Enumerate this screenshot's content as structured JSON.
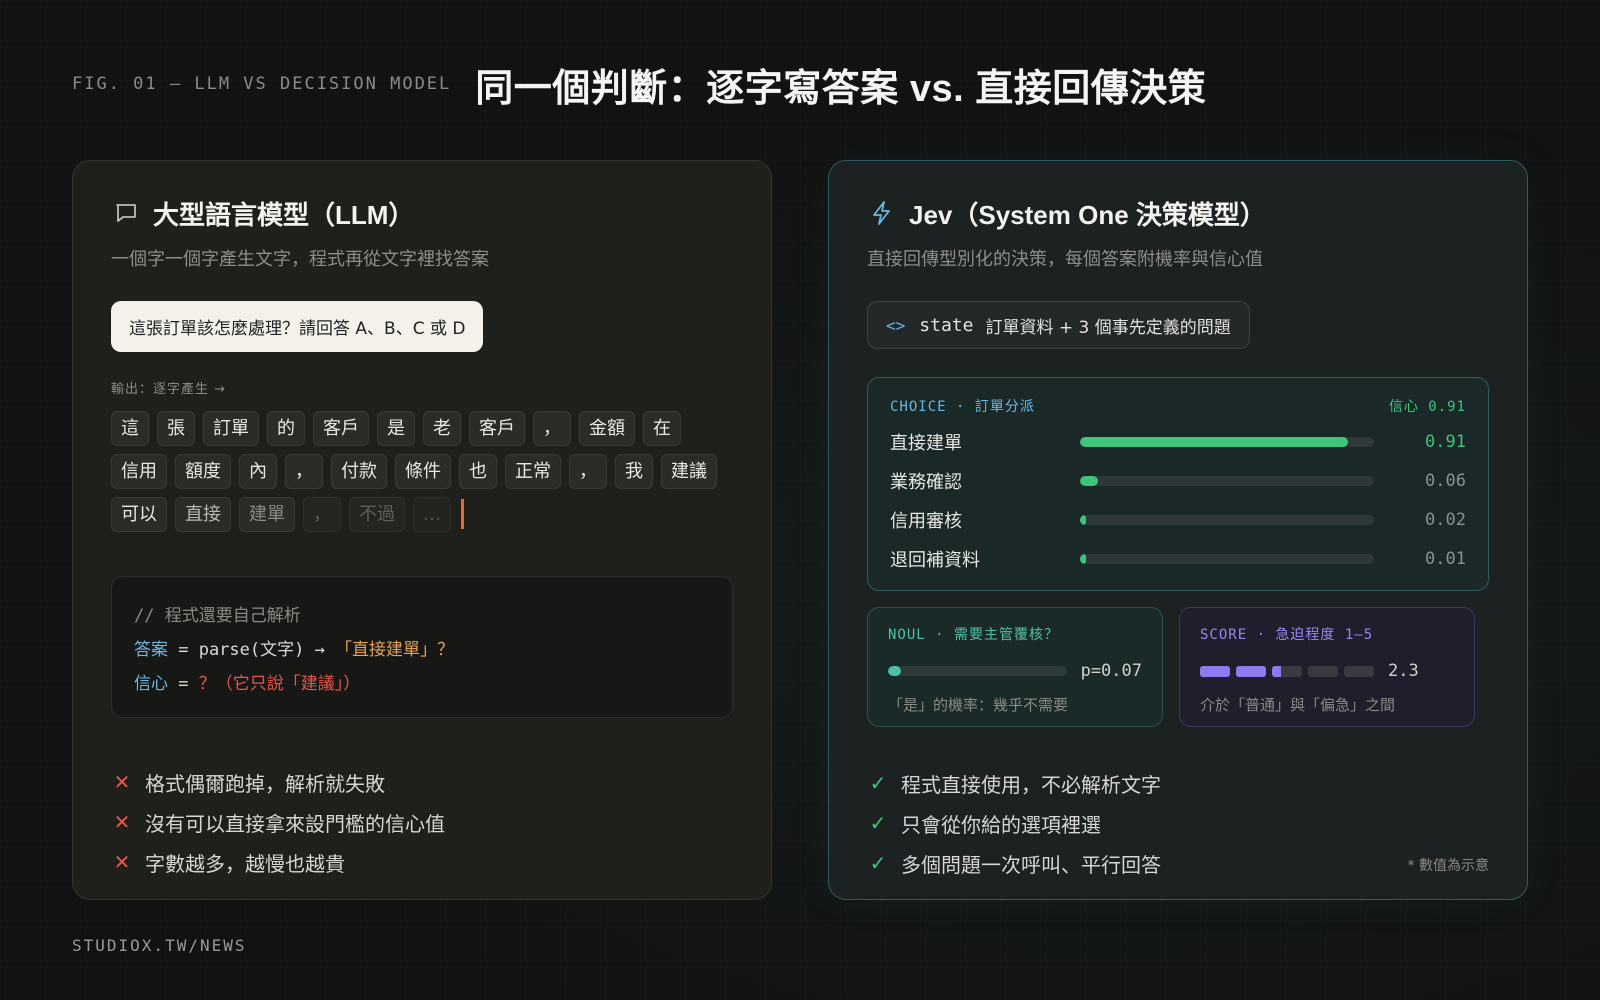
{
  "header": {
    "fig_label": "FIG. 01 — LLM VS DECISION MODEL",
    "title": "同一個判斷：逐字寫答案 vs. 直接回傳決策"
  },
  "left": {
    "icon": "chat-bubble-icon",
    "title": "大型語言模型（LLM）",
    "subtitle": "一個字一個字產生文字，程式再從文字裡找答案",
    "prompt": "這張訂單該怎麼處理？請回答 A、B、C 或 D",
    "output_label": "輸出：逐字產生 →",
    "tokens": [
      "這",
      "張",
      "訂單",
      "的",
      "客戶",
      "是",
      "老",
      "客戶",
      "，",
      "金額",
      "在",
      "信用",
      "額度",
      "內",
      "，",
      "付款",
      "條件",
      "也",
      "正常",
      "，",
      "我",
      "建議",
      "可以",
      "直接",
      "建單",
      "，",
      "不過",
      "…"
    ],
    "code": {
      "comment": "// 程式還要自己解析",
      "line1_var": "答案",
      "line1_op": " = parse(文字) → ",
      "line1_str": "「直接建單」？",
      "line2_var": "信心",
      "line2_op": " = ",
      "line2_red": "？（它只說「建議」）"
    },
    "bullets": [
      "格式偶爾跑掉，解析就失敗",
      "沒有可以直接拿來設門檻的信心值",
      "字數越多，越慢也越貴"
    ]
  },
  "right": {
    "icon": "lightning-icon",
    "title": "Jev（System One 決策模型）",
    "subtitle": "直接回傳型別化的決策，每個答案附機率與信心值",
    "state": {
      "code_icon": "<>",
      "keyword": "state",
      "text": "訂單資料 + 3 個事先定義的問題"
    },
    "choice": {
      "label": "CHOICE · 訂單分派",
      "confidence": "信心 0.91",
      "options": [
        {
          "name": "直接建單",
          "value": 0.91,
          "label": "0.91"
        },
        {
          "name": "業務確認",
          "value": 0.06,
          "label": "0.06"
        },
        {
          "name": "信用審核",
          "value": 0.02,
          "label": "0.02"
        },
        {
          "name": "退回補資料",
          "value": 0.01,
          "label": "0.01"
        }
      ]
    },
    "noul": {
      "label": "NOUL · 需要主管覆核？",
      "value": 0.07,
      "value_label": "p=0.07",
      "note": "「是」的機率：幾乎不需要"
    },
    "score": {
      "label": "SCORE · 急迫程度 1–5",
      "value": 2.3,
      "max": 5,
      "value_label": "2.3",
      "note": "介於「普通」與「偏急」之間"
    },
    "bullets": [
      "程式直接使用，不必解析文字",
      "只會從你給的選項裡選",
      "多個問題一次呼叫、平行回答"
    ],
    "footnote": "* 數值為示意"
  },
  "footer": "STUDIOX.TW/NEWS",
  "colors": {
    "green": "#3fc47c",
    "red": "#e5574a",
    "blue": "#6ab8e0",
    "teal": "#4ec0a8",
    "purple": "#8f78f0",
    "orange": "#e86a3c"
  }
}
